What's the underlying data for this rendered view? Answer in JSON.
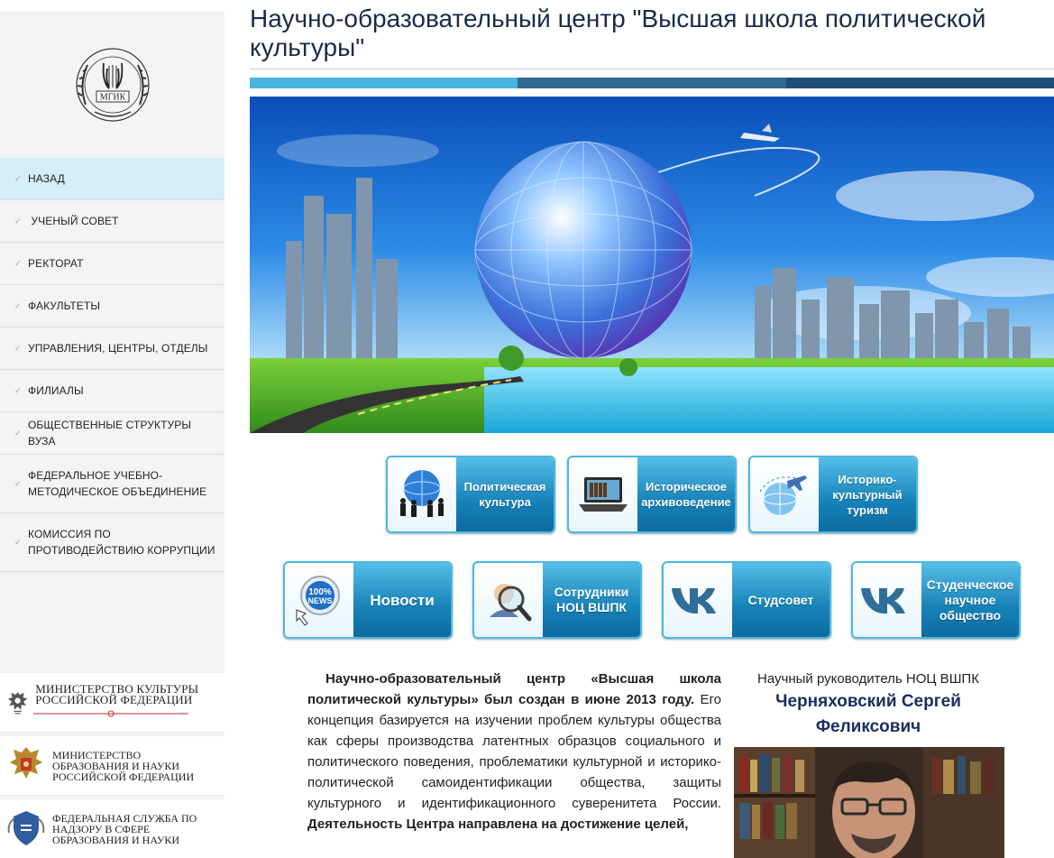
{
  "sidebar": {
    "logo_text": "МГИК",
    "nav": [
      {
        "label": "НАЗАД",
        "active": true
      },
      {
        "label": " УЧЕНЫЙ СОВЕТ",
        "active": false
      },
      {
        "label": "РЕКТОРАТ",
        "active": false
      },
      {
        "label": "ФАКУЛЬТЕТЫ",
        "active": false
      },
      {
        "label": "УПРАВЛЕНИЯ, ЦЕНТРЫ, ОТДЕЛЫ",
        "active": false
      },
      {
        "label": "ФИЛИАЛЫ",
        "active": false
      },
      {
        "label": "ОБЩЕСТВЕННЫЕ СТРУКТУРЫ ВУЗА",
        "active": false
      },
      {
        "label": "ФЕДЕРАЛЬНОЕ УЧЕБНО-МЕТОДИЧЕСКОЕ ОБЪЕДИНЕНИЕ",
        "active": false
      },
      {
        "label": "КОМИССИЯ ПО ПРОТИВОДЕЙСТВИЮ КОРРУПЦИИ",
        "active": false
      }
    ],
    "partners": [
      {
        "text": "МИНИСТЕРСТВО КУЛЬТУРЫ РОССИЙСКОЙ ФЕДЕРАЦИИ",
        "icon": "eagle-crest-icon"
      },
      {
        "text": "МИНИСТЕРСТВО ОБРАЗОВАНИЯ И НАУКИ РОССИЙСКОЙ ФЕДЕРАЦИИ",
        "icon": "coat-of-arms-icon"
      },
      {
        "text": "ФЕДЕРАЛЬНАЯ СЛУЖБА ПО НАДЗОРУ В СФЕРЕ ОБРАЗОВАНИЯ И НАУКИ",
        "icon": "supervision-emblem-icon"
      }
    ]
  },
  "main": {
    "title": "Научно-образовательный центр \"Высшая школа политической культуры\"",
    "stripe_colors": [
      "#4ab3e0",
      "#2f6a8f",
      "#214f78"
    ],
    "tiles_row1": [
      {
        "label": "Политическая культура",
        "icon": "globe-people-icon"
      },
      {
        "label": "Историческое архивоведение",
        "icon": "laptop-archive-icon"
      },
      {
        "label": "Историко-культурный туризм",
        "icon": "globe-plane-icon"
      }
    ],
    "tiles_row2": [
      {
        "label": "Новости",
        "icon": "news-badge-icon"
      },
      {
        "label": "Сотрудники НОЦ ВШПК",
        "icon": "magnifier-person-icon"
      },
      {
        "label": "Студсовет",
        "icon": "vk-logo-icon"
      },
      {
        "label": "Студенческое научное общество",
        "icon": "vk-logo-icon"
      }
    ],
    "article": {
      "lead": "Научно-образовательный центр «Высшая школа политической культуры» был создан в июне 2013 году.",
      "body": " Его концепция базируется на изучении проблем культуры общества как сферы производства латентных образцов социального и политического поведения, проблематики культурной и историко-политической самоидентификации общества, защиты культурного и идентификационного суверенитета России. ",
      "bold_tail": "Деятельность Центра направлена на достижение целей,"
    },
    "head": {
      "role": "Научный руководитель НОЦ ВШПК",
      "name": "Черняховский Сергей Феликсович"
    }
  },
  "colors": {
    "accent": "#4ab8e4",
    "tile_face": "#1682b8",
    "active_nav": "#d4eef8",
    "name_color": "#1a2f60"
  }
}
